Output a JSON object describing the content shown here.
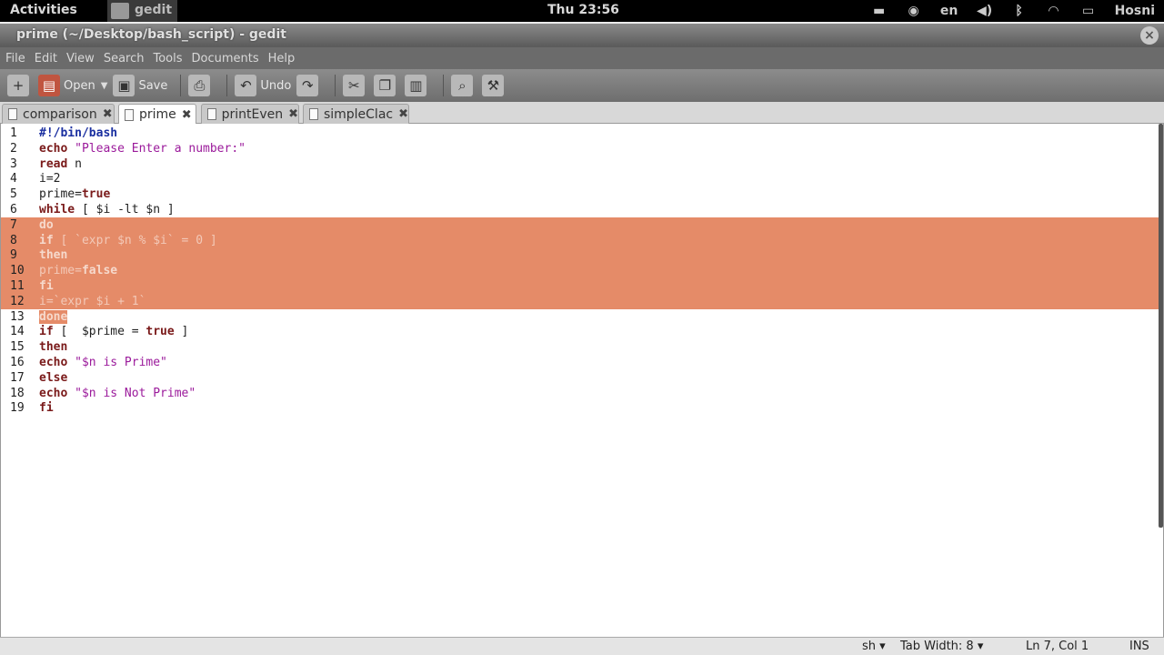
{
  "topbar": {
    "activities": "Activities",
    "app_name": "gedit",
    "clock": "Thu 23:56",
    "lang": "en",
    "user": "Hosni"
  },
  "window": {
    "title": "prime (~/Desktop/bash_script) - gedit"
  },
  "menu": {
    "items": [
      "File",
      "Edit",
      "View",
      "Search",
      "Tools",
      "Documents",
      "Help"
    ]
  },
  "toolbar": {
    "open_label": "Open",
    "save_label": "Save",
    "undo_label": "Undo"
  },
  "tabs": [
    {
      "label": "comparison"
    },
    {
      "label": "prime"
    },
    {
      "label": "printEven"
    },
    {
      "label": "simpleClac"
    }
  ],
  "editor": {
    "lines": [
      {
        "num": "1",
        "text": "#!/bin/bash"
      },
      {
        "num": "2",
        "text": "echo \"Please Enter a number:\""
      },
      {
        "num": "3",
        "text": "read n"
      },
      {
        "num": "4",
        "text": "i=2"
      },
      {
        "num": "5",
        "text": "prime=true"
      },
      {
        "num": "6",
        "text": "while [ $i -lt $n ]"
      },
      {
        "num": "7",
        "text": "do"
      },
      {
        "num": "8",
        "text": "if [ `expr $n % $i` = 0 ]"
      },
      {
        "num": "9",
        "text": "then"
      },
      {
        "num": "10",
        "text": "prime=false"
      },
      {
        "num": "11",
        "text": "fi"
      },
      {
        "num": "12",
        "text": "i=`expr $i + 1`"
      },
      {
        "num": "13",
        "text": "done"
      },
      {
        "num": "14",
        "text": "if [  $prime = true ]"
      },
      {
        "num": "15",
        "text": "then"
      },
      {
        "num": "16",
        "text": "echo \"$n is Prime\""
      },
      {
        "num": "17",
        "text": "else"
      },
      {
        "num": "18",
        "text": "echo \"$n is Not Prime\""
      },
      {
        "num": "19",
        "text": "fi"
      }
    ],
    "selection_color": "#e58b68"
  },
  "statusbar": {
    "language": "sh ▾",
    "tab_width": "Tab Width: 8 ▾",
    "position": "Ln 7, Col 1",
    "mode": "INS"
  }
}
